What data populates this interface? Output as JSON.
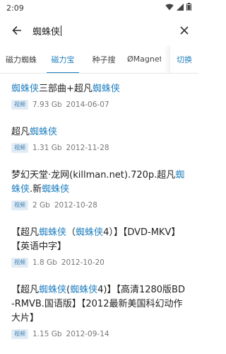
{
  "status": {
    "time": "2:09"
  },
  "search": {
    "query": "蜘蛛侠"
  },
  "tabs": [
    {
      "label": "磁力蜘蛛",
      "active": false
    },
    {
      "label": "磁力宝",
      "active": true
    },
    {
      "label": "种子搜",
      "active": false
    },
    {
      "label": "ØMagnet",
      "active": false
    }
  ],
  "tab_switch": "切换",
  "results": [
    {
      "title_parts": [
        {
          "text": "蜘蛛侠",
          "hl": true
        },
        {
          "text": "三部曲+超凡",
          "hl": false
        },
        {
          "text": "蜘蛛侠",
          "hl": true
        }
      ],
      "badge": "视频",
      "size": "7.93 Gb",
      "date": "2014-06-07"
    },
    {
      "title_parts": [
        {
          "text": "超凡",
          "hl": false
        },
        {
          "text": "蜘蛛侠",
          "hl": true
        }
      ],
      "badge": "视频",
      "size": "1.31 Gb",
      "date": "2012-11-28"
    },
    {
      "title_parts": [
        {
          "text": "梦幻天堂·龙网(killman.net).720p.超凡",
          "hl": false
        },
        {
          "text": "蜘蛛侠",
          "hl": true
        },
        {
          "text": ".新",
          "hl": false
        },
        {
          "text": "蜘蛛侠",
          "hl": true
        }
      ],
      "badge": "视频",
      "size": "2 Gb",
      "date": "2012-10-28"
    },
    {
      "title_parts": [
        {
          "text": "【超凡",
          "hl": false
        },
        {
          "text": "蜘蛛侠",
          "hl": true
        },
        {
          "text": "（",
          "hl": false
        },
        {
          "text": "蜘蛛侠",
          "hl": true
        },
        {
          "text": "4）】【DVD-MKV】【英语中字】",
          "hl": false
        }
      ],
      "badge": "视频",
      "size": "1.8 Gb",
      "date": "2012-10-20"
    },
    {
      "title_parts": [
        {
          "text": "【超凡",
          "hl": false
        },
        {
          "text": "蜘蛛侠",
          "hl": true
        },
        {
          "text": "(",
          "hl": false
        },
        {
          "text": "蜘蛛侠",
          "hl": true
        },
        {
          "text": "4)】【高清1280版BD-RMVB.国语版】【2012最新美国科幻动作大片】",
          "hl": false
        }
      ],
      "badge": "视频",
      "size": "1.15 Gb",
      "date": "2012-09-14"
    }
  ],
  "colors": {
    "accent": "#1f7fbf",
    "badge_bg": "#e2ecf5"
  }
}
